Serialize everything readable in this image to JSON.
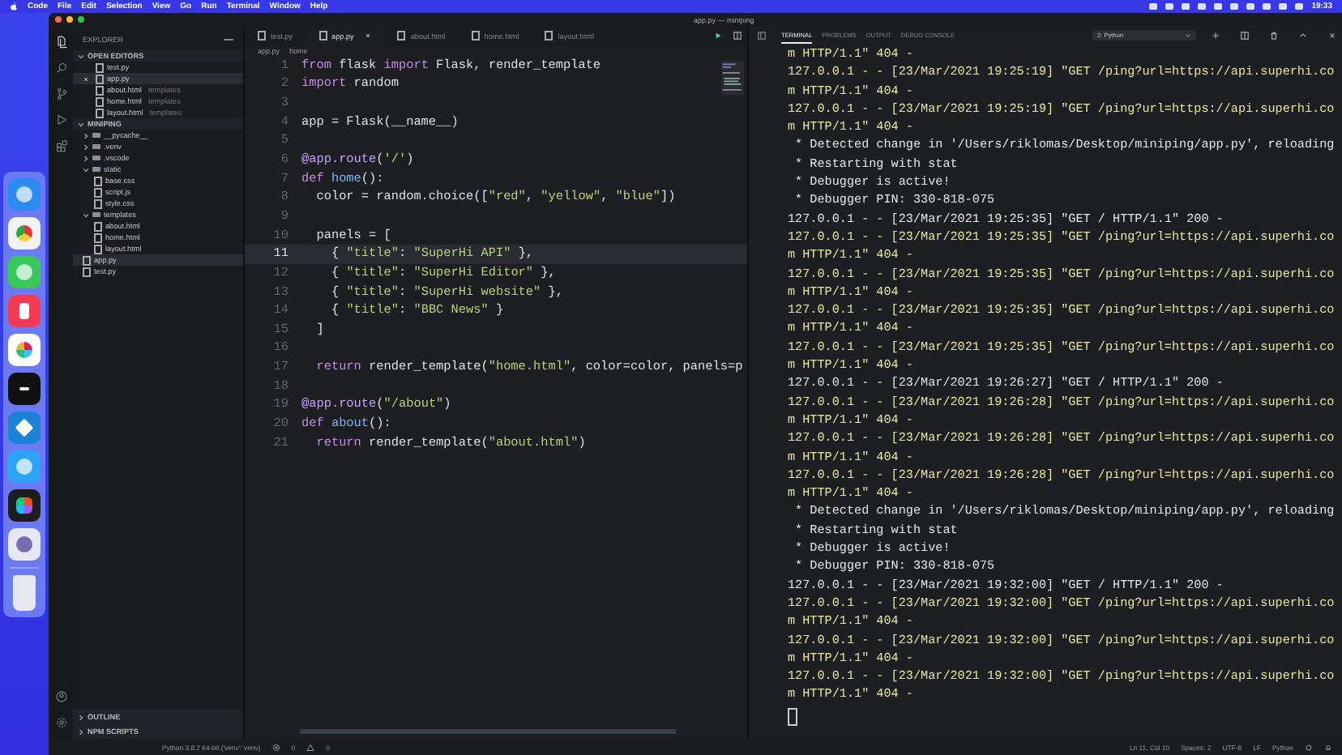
{
  "menubar": {
    "app": "Code",
    "items": [
      "File",
      "Edit",
      "Selection",
      "View",
      "Go",
      "Run",
      "Terminal",
      "Window",
      "Help"
    ],
    "clock": "19:33"
  },
  "window": {
    "title": "app.py — miniping"
  },
  "sidebar": {
    "title": "EXPLORER",
    "sections": [
      {
        "title": "OPEN EDITORS",
        "expanded": true,
        "items": [
          {
            "kind": "file",
            "name": "test.py",
            "selected": false
          },
          {
            "kind": "file",
            "name": "app.py",
            "selected": true
          },
          {
            "kind": "file",
            "name": "about.html",
            "hint": "templates",
            "selected": false
          },
          {
            "kind": "file",
            "name": "home.html",
            "hint": "templates",
            "selected": false
          },
          {
            "kind": "file",
            "name": "layout.html",
            "hint": "templates",
            "selected": false
          }
        ]
      },
      {
        "title": "MINIPING",
        "expanded": true,
        "items": [
          {
            "kind": "folder",
            "name": "__pycache__",
            "expanded": false,
            "selected": false
          },
          {
            "kind": "folder",
            "name": ".venv",
            "expanded": false,
            "selected": false
          },
          {
            "kind": "folder",
            "name": ".vscode",
            "expanded": false,
            "selected": false
          },
          {
            "kind": "folder",
            "name": "static",
            "expanded": true,
            "selected": false,
            "children": [
              {
                "kind": "file",
                "name": "base.css",
                "selected": false
              },
              {
                "kind": "file",
                "name": "script.js",
                "selected": false
              },
              {
                "kind": "file",
                "name": "style.css",
                "selected": false
              }
            ]
          },
          {
            "kind": "folder",
            "name": "templates",
            "expanded": true,
            "selected": false,
            "children": [
              {
                "kind": "file",
                "name": "about.html",
                "selected": false
              },
              {
                "kind": "file",
                "name": "home.html",
                "selected": false
              },
              {
                "kind": "file",
                "name": "layout.html",
                "selected": false
              }
            ]
          },
          {
            "kind": "file",
            "name": "app.py",
            "selected": true
          },
          {
            "kind": "file",
            "name": "test.py",
            "selected": false
          }
        ]
      }
    ],
    "footer_sections": [
      {
        "title": "OUTLINE",
        "expanded": false
      },
      {
        "title": "NPM SCRIPTS",
        "expanded": false
      }
    ]
  },
  "editor": {
    "tabs": [
      {
        "label": "test.py",
        "selected": false
      },
      {
        "label": "app.py",
        "selected": true
      },
      {
        "label": "about.html",
        "selected": false
      },
      {
        "label": "home.html",
        "selected": false
      },
      {
        "label": "layout.html",
        "selected": false
      }
    ],
    "breadcrumb": [
      "app.py",
      "home"
    ],
    "lines": [
      {
        "number": "1",
        "current": false,
        "tokens": [
          {
            "kind": "kw",
            "text": "from"
          },
          {
            "kind": "plain",
            "text": " flask "
          },
          {
            "kind": "kw",
            "text": "import"
          },
          {
            "kind": "plain",
            "text": " Flask, render_template"
          }
        ]
      },
      {
        "number": "2",
        "current": false,
        "tokens": [
          {
            "kind": "kw",
            "text": "import"
          },
          {
            "kind": "plain",
            "text": " random"
          }
        ]
      },
      {
        "number": "3",
        "current": false
      },
      {
        "number": "4",
        "current": false,
        "tokens": [
          {
            "kind": "plain",
            "text": "app = Flask(__name__)"
          }
        ]
      },
      {
        "number": "5",
        "current": false
      },
      {
        "number": "6",
        "current": false,
        "tokens": [
          {
            "kind": "dec",
            "text": "@app.route"
          },
          {
            "kind": "plain",
            "text": "("
          },
          {
            "kind": "str",
            "text": "'/'"
          },
          {
            "kind": "plain",
            "text": ")"
          }
        ]
      },
      {
        "number": "7",
        "current": false,
        "tokens": [
          {
            "kind": "kw",
            "text": "def"
          },
          {
            "kind": "fn",
            "text": " home"
          },
          {
            "kind": "plain",
            "text": "():"
          }
        ]
      },
      {
        "number": "8",
        "current": false,
        "tokens": [
          {
            "kind": "plain",
            "text": "  color = random.choice(["
          },
          {
            "kind": "str",
            "text": "\"red\""
          },
          {
            "kind": "plain",
            "text": ", "
          },
          {
            "kind": "str",
            "text": "\"yellow\""
          },
          {
            "kind": "plain",
            "text": ", "
          },
          {
            "kind": "str",
            "text": "\"blue\""
          },
          {
            "kind": "plain",
            "text": "])"
          }
        ]
      },
      {
        "number": "9",
        "current": false
      },
      {
        "number": "10",
        "current": false,
        "tokens": [
          {
            "kind": "plain",
            "text": "  panels = ["
          }
        ]
      },
      {
        "number": "11",
        "current": true,
        "tokens": [
          {
            "kind": "plain",
            "text": "    { "
          },
          {
            "kind": "str",
            "text": "\"title\""
          },
          {
            "kind": "plain",
            "text": ": "
          },
          {
            "kind": "str",
            "text": "\"SuperHi API\""
          },
          {
            "kind": "plain",
            "text": " },"
          }
        ]
      },
      {
        "number": "12",
        "current": false,
        "tokens": [
          {
            "kind": "plain",
            "text": "    { "
          },
          {
            "kind": "str",
            "text": "\"title\""
          },
          {
            "kind": "plain",
            "text": ": "
          },
          {
            "kind": "str",
            "text": "\"SuperHi Editor\""
          },
          {
            "kind": "plain",
            "text": " },"
          }
        ]
      },
      {
        "number": "13",
        "current": false,
        "tokens": [
          {
            "kind": "plain",
            "text": "    { "
          },
          {
            "kind": "str",
            "text": "\"title\""
          },
          {
            "kind": "plain",
            "text": ": "
          },
          {
            "kind": "str",
            "text": "\"SuperHi website\""
          },
          {
            "kind": "plain",
            "text": " },"
          }
        ]
      },
      {
        "number": "14",
        "current": false,
        "tokens": [
          {
            "kind": "plain",
            "text": "    { "
          },
          {
            "kind": "str",
            "text": "\"title\""
          },
          {
            "kind": "plain",
            "text": ": "
          },
          {
            "kind": "str",
            "text": "\"BBC News\""
          },
          {
            "kind": "plain",
            "text": " }"
          }
        ]
      },
      {
        "number": "15",
        "current": false,
        "tokens": [
          {
            "kind": "plain",
            "text": "  ]"
          }
        ]
      },
      {
        "number": "16",
        "current": false
      },
      {
        "number": "17",
        "current": false,
        "tokens": [
          {
            "kind": "kw",
            "text": "  return"
          },
          {
            "kind": "plain",
            "text": " render_template("
          },
          {
            "kind": "str",
            "text": "\"home.html\""
          },
          {
            "kind": "plain",
            "text": ", color=color, panels=p"
          }
        ]
      },
      {
        "number": "18",
        "current": false
      },
      {
        "number": "19",
        "current": false,
        "tokens": [
          {
            "kind": "dec",
            "text": "@app.route"
          },
          {
            "kind": "plain",
            "text": "("
          },
          {
            "kind": "str",
            "text": "\"/about\""
          },
          {
            "kind": "plain",
            "text": ")"
          }
        ]
      },
      {
        "number": "20",
        "current": false,
        "tokens": [
          {
            "kind": "kw",
            "text": "def"
          },
          {
            "kind": "fn",
            "text": " about"
          },
          {
            "kind": "plain",
            "text": "():"
          }
        ]
      },
      {
        "number": "21",
        "current": false,
        "tokens": [
          {
            "kind": "kw",
            "text": "  return"
          },
          {
            "kind": "plain",
            "text": " render_template("
          },
          {
            "kind": "str",
            "text": "\"about.html\""
          },
          {
            "kind": "plain",
            "text": ")"
          }
        ]
      }
    ]
  },
  "terminal": {
    "tabs": [
      {
        "label": "TERMINAL",
        "selected": true
      },
      {
        "label": "PROBLEMS",
        "selected": false
      },
      {
        "label": "OUTPUT",
        "selected": false
      },
      {
        "label": "DEBUG CONSOLE",
        "selected": false
      }
    ],
    "shell": "2: Python",
    "lines": [
      {
        "kind": "warn",
        "text": "m HTTP/1.1\" 404 -"
      },
      {
        "kind": "warn",
        "text": "127.0.0.1 - - [23/Mar/2021 19:25:19] \"GET /ping?url=https://api.superhi.co"
      },
      {
        "kind": "warn",
        "text": "m HTTP/1.1\" 404 -"
      },
      {
        "kind": "warn",
        "text": "127.0.0.1 - - [23/Mar/2021 19:25:19] \"GET /ping?url=https://api.superhi.co"
      },
      {
        "kind": "warn",
        "text": "m HTTP/1.1\" 404 -"
      },
      {
        "kind": "plain",
        "text": " * Detected change in '/Users/riklomas/Desktop/miniping/app.py', reloading"
      },
      {
        "kind": "plain",
        "text": " * Restarting with stat"
      },
      {
        "kind": "plain",
        "text": " * Debugger is active!"
      },
      {
        "kind": "plain",
        "text": " * Debugger PIN: 330-818-075"
      },
      {
        "kind": "plain",
        "text": "127.0.0.1 - - [23/Mar/2021 19:25:35] \"GET / HTTP/1.1\" 200 -"
      },
      {
        "kind": "warn",
        "text": "127.0.0.1 - - [23/Mar/2021 19:25:35] \"GET /ping?url=https://api.superhi.co"
      },
      {
        "kind": "warn",
        "text": "m HTTP/1.1\" 404 -"
      },
      {
        "kind": "warn",
        "text": "127.0.0.1 - - [23/Mar/2021 19:25:35] \"GET /ping?url=https://api.superhi.co"
      },
      {
        "kind": "warn",
        "text": "m HTTP/1.1\" 404 -"
      },
      {
        "kind": "warn",
        "text": "127.0.0.1 - - [23/Mar/2021 19:25:35] \"GET /ping?url=https://api.superhi.co"
      },
      {
        "kind": "warn",
        "text": "m HTTP/1.1\" 404 -"
      },
      {
        "kind": "warn",
        "text": "127.0.0.1 - - [23/Mar/2021 19:25:35] \"GET /ping?url=https://api.superhi.co"
      },
      {
        "kind": "warn",
        "text": "m HTTP/1.1\" 404 -"
      },
      {
        "kind": "plain",
        "text": "127.0.0.1 - - [23/Mar/2021 19:26:27] \"GET / HTTP/1.1\" 200 -"
      },
      {
        "kind": "warn",
        "text": "127.0.0.1 - - [23/Mar/2021 19:26:28] \"GET /ping?url=https://api.superhi.co"
      },
      {
        "kind": "warn",
        "text": "m HTTP/1.1\" 404 -"
      },
      {
        "kind": "warn",
        "text": "127.0.0.1 - - [23/Mar/2021 19:26:28] \"GET /ping?url=https://api.superhi.co"
      },
      {
        "kind": "warn",
        "text": "m HTTP/1.1\" 404 -"
      },
      {
        "kind": "warn",
        "text": "127.0.0.1 - - [23/Mar/2021 19:26:28] \"GET /ping?url=https://api.superhi.co"
      },
      {
        "kind": "warn",
        "text": "m HTTP/1.1\" 404 -"
      },
      {
        "kind": "plain",
        "text": " * Detected change in '/Users/riklomas/Desktop/miniping/app.py', reloading"
      },
      {
        "kind": "plain",
        "text": " * Restarting with stat"
      },
      {
        "kind": "plain",
        "text": " * Debugger is active!"
      },
      {
        "kind": "plain",
        "text": " * Debugger PIN: 330-818-075"
      },
      {
        "kind": "plain",
        "text": "127.0.0.1 - - [23/Mar/2021 19:32:00] \"GET / HTTP/1.1\" 200 -"
      },
      {
        "kind": "warn",
        "text": "127.0.0.1 - - [23/Mar/2021 19:32:00] \"GET /ping?url=https://api.superhi.co"
      },
      {
        "kind": "warn",
        "text": "m HTTP/1.1\" 404 -"
      },
      {
        "kind": "warn",
        "text": "127.0.0.1 - - [23/Mar/2021 19:32:00] \"GET /ping?url=https://api.superhi.co"
      },
      {
        "kind": "warn",
        "text": "m HTTP/1.1\" 404 -"
      },
      {
        "kind": "warn",
        "text": "127.0.0.1 - - [23/Mar/2021 19:32:00] \"GET /ping?url=https://api.superhi.co"
      },
      {
        "kind": "warn",
        "text": "m HTTP/1.1\" 404 -"
      }
    ]
  },
  "status_bar": {
    "interpreter": "Python 3.8.2 64-bit ('venv': venv)",
    "errors": "0",
    "warnings": "0",
    "right": [
      "Ln 11, Col 10",
      "Spaces: 2",
      "UTF-8",
      "LF",
      "Python"
    ]
  }
}
